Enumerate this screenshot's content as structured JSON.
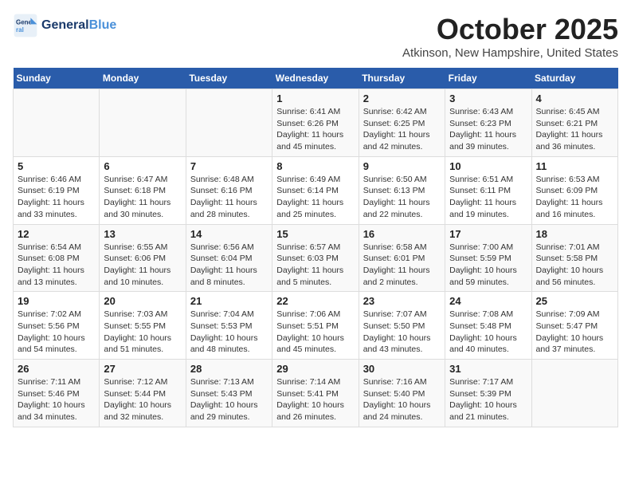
{
  "header": {
    "logo_line1": "General",
    "logo_line2": "Blue",
    "month": "October 2025",
    "location": "Atkinson, New Hampshire, United States"
  },
  "weekdays": [
    "Sunday",
    "Monday",
    "Tuesday",
    "Wednesday",
    "Thursday",
    "Friday",
    "Saturday"
  ],
  "weeks": [
    [
      {
        "day": "",
        "info": ""
      },
      {
        "day": "",
        "info": ""
      },
      {
        "day": "",
        "info": ""
      },
      {
        "day": "1",
        "info": "Sunrise: 6:41 AM\nSunset: 6:26 PM\nDaylight: 11 hours\nand 45 minutes."
      },
      {
        "day": "2",
        "info": "Sunrise: 6:42 AM\nSunset: 6:25 PM\nDaylight: 11 hours\nand 42 minutes."
      },
      {
        "day": "3",
        "info": "Sunrise: 6:43 AM\nSunset: 6:23 PM\nDaylight: 11 hours\nand 39 minutes."
      },
      {
        "day": "4",
        "info": "Sunrise: 6:45 AM\nSunset: 6:21 PM\nDaylight: 11 hours\nand 36 minutes."
      }
    ],
    [
      {
        "day": "5",
        "info": "Sunrise: 6:46 AM\nSunset: 6:19 PM\nDaylight: 11 hours\nand 33 minutes."
      },
      {
        "day": "6",
        "info": "Sunrise: 6:47 AM\nSunset: 6:18 PM\nDaylight: 11 hours\nand 30 minutes."
      },
      {
        "day": "7",
        "info": "Sunrise: 6:48 AM\nSunset: 6:16 PM\nDaylight: 11 hours\nand 28 minutes."
      },
      {
        "day": "8",
        "info": "Sunrise: 6:49 AM\nSunset: 6:14 PM\nDaylight: 11 hours\nand 25 minutes."
      },
      {
        "day": "9",
        "info": "Sunrise: 6:50 AM\nSunset: 6:13 PM\nDaylight: 11 hours\nand 22 minutes."
      },
      {
        "day": "10",
        "info": "Sunrise: 6:51 AM\nSunset: 6:11 PM\nDaylight: 11 hours\nand 19 minutes."
      },
      {
        "day": "11",
        "info": "Sunrise: 6:53 AM\nSunset: 6:09 PM\nDaylight: 11 hours\nand 16 minutes."
      }
    ],
    [
      {
        "day": "12",
        "info": "Sunrise: 6:54 AM\nSunset: 6:08 PM\nDaylight: 11 hours\nand 13 minutes."
      },
      {
        "day": "13",
        "info": "Sunrise: 6:55 AM\nSunset: 6:06 PM\nDaylight: 11 hours\nand 10 minutes."
      },
      {
        "day": "14",
        "info": "Sunrise: 6:56 AM\nSunset: 6:04 PM\nDaylight: 11 hours\nand 8 minutes."
      },
      {
        "day": "15",
        "info": "Sunrise: 6:57 AM\nSunset: 6:03 PM\nDaylight: 11 hours\nand 5 minutes."
      },
      {
        "day": "16",
        "info": "Sunrise: 6:58 AM\nSunset: 6:01 PM\nDaylight: 11 hours\nand 2 minutes."
      },
      {
        "day": "17",
        "info": "Sunrise: 7:00 AM\nSunset: 5:59 PM\nDaylight: 10 hours\nand 59 minutes."
      },
      {
        "day": "18",
        "info": "Sunrise: 7:01 AM\nSunset: 5:58 PM\nDaylight: 10 hours\nand 56 minutes."
      }
    ],
    [
      {
        "day": "19",
        "info": "Sunrise: 7:02 AM\nSunset: 5:56 PM\nDaylight: 10 hours\nand 54 minutes."
      },
      {
        "day": "20",
        "info": "Sunrise: 7:03 AM\nSunset: 5:55 PM\nDaylight: 10 hours\nand 51 minutes."
      },
      {
        "day": "21",
        "info": "Sunrise: 7:04 AM\nSunset: 5:53 PM\nDaylight: 10 hours\nand 48 minutes."
      },
      {
        "day": "22",
        "info": "Sunrise: 7:06 AM\nSunset: 5:51 PM\nDaylight: 10 hours\nand 45 minutes."
      },
      {
        "day": "23",
        "info": "Sunrise: 7:07 AM\nSunset: 5:50 PM\nDaylight: 10 hours\nand 43 minutes."
      },
      {
        "day": "24",
        "info": "Sunrise: 7:08 AM\nSunset: 5:48 PM\nDaylight: 10 hours\nand 40 minutes."
      },
      {
        "day": "25",
        "info": "Sunrise: 7:09 AM\nSunset: 5:47 PM\nDaylight: 10 hours\nand 37 minutes."
      }
    ],
    [
      {
        "day": "26",
        "info": "Sunrise: 7:11 AM\nSunset: 5:46 PM\nDaylight: 10 hours\nand 34 minutes."
      },
      {
        "day": "27",
        "info": "Sunrise: 7:12 AM\nSunset: 5:44 PM\nDaylight: 10 hours\nand 32 minutes."
      },
      {
        "day": "28",
        "info": "Sunrise: 7:13 AM\nSunset: 5:43 PM\nDaylight: 10 hours\nand 29 minutes."
      },
      {
        "day": "29",
        "info": "Sunrise: 7:14 AM\nSunset: 5:41 PM\nDaylight: 10 hours\nand 26 minutes."
      },
      {
        "day": "30",
        "info": "Sunrise: 7:16 AM\nSunset: 5:40 PM\nDaylight: 10 hours\nand 24 minutes."
      },
      {
        "day": "31",
        "info": "Sunrise: 7:17 AM\nSunset: 5:39 PM\nDaylight: 10 hours\nand 21 minutes."
      },
      {
        "day": "",
        "info": ""
      }
    ]
  ]
}
